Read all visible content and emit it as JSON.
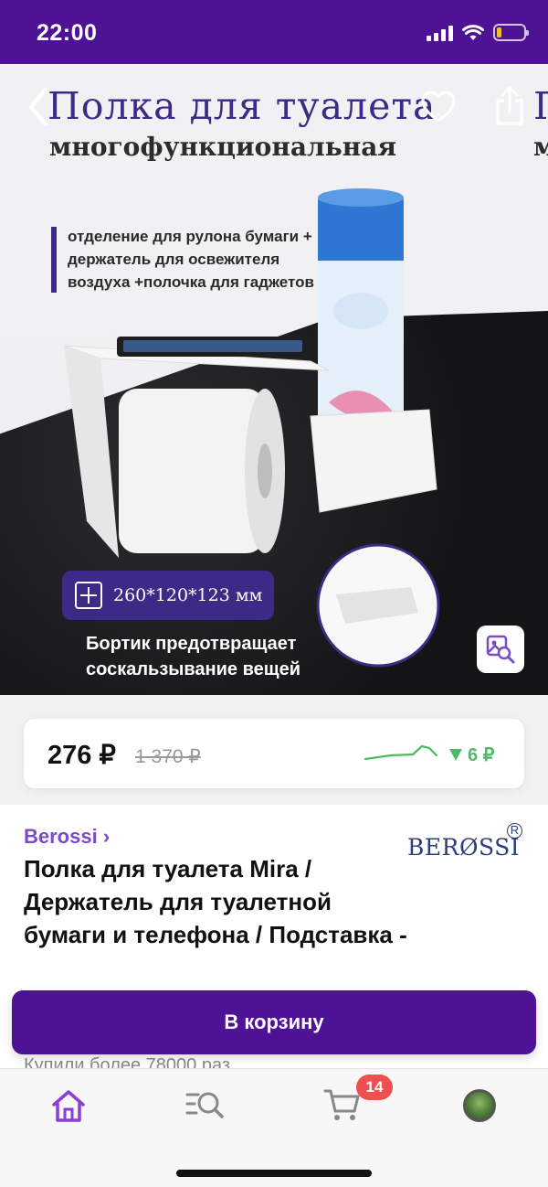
{
  "status_bar": {
    "time": "22:00"
  },
  "product_image": {
    "title": "Полка для туалета",
    "subtitle": "многофункциональная",
    "features_text": "отделение для рулона бумаги + держатель для освежителя воздуха +полочка для гаджетов",
    "dimensions": "260*120*123 мм",
    "caption": "Бортик предотвращает соскальзывание вещей",
    "next_image_peek_title": "П",
    "next_image_peek_subtitle": "м"
  },
  "price": {
    "current": "276 ₽",
    "old": "1 370 ₽",
    "drop": "6 ₽",
    "accent_color": "#4cbc64"
  },
  "details": {
    "brand_link": "Berossi ›",
    "brand_logo_text": "BERØSSI",
    "brand_logo_reg": "R",
    "title": "Полка для туалета Mira / Держатель для туалетной бумаги и телефона / Подставка - ",
    "bought_text": "Купили более 78000 раз"
  },
  "cart_button": {
    "label": "В корзину"
  },
  "bottom_nav": {
    "items": [
      {
        "icon": "home-icon"
      },
      {
        "icon": "catalog-search-icon"
      },
      {
        "icon": "cart-icon",
        "badge": "14"
      },
      {
        "icon": "profile-avatar"
      }
    ]
  },
  "colors": {
    "brand": "#4d1394",
    "link": "#7c4bc4",
    "badge": "#f04f4f"
  }
}
